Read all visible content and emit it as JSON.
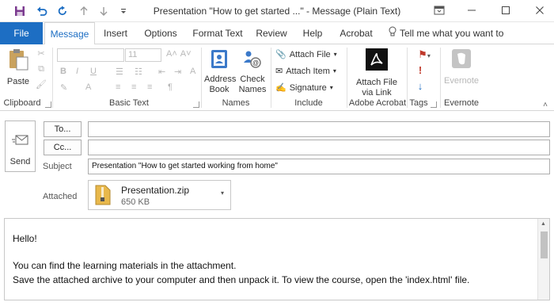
{
  "window": {
    "title": "Presentation \"How to get started ...\"  -  Message (Plain Text)"
  },
  "icons": {
    "save": "save-icon",
    "undo": "undo-icon",
    "redo": "redo-icon",
    "up": "arrow-up-icon",
    "down": "arrow-down-icon",
    "customize": "customize-qat-icon"
  },
  "tabs": [
    "File",
    "Message",
    "Insert",
    "Options",
    "Format Text",
    "Review",
    "Help",
    "Acrobat"
  ],
  "tell_me": "Tell me what you want to do",
  "ribbon": {
    "clipboard": {
      "paste": "Paste",
      "label": "Clipboard"
    },
    "basic_text": {
      "font_size": "11",
      "label": "Basic Text"
    },
    "names": {
      "address_book_1": "Address",
      "address_book_2": "Book",
      "check_names_1": "Check",
      "check_names_2": "Names",
      "label": "Names"
    },
    "include": {
      "attach_file": "Attach File",
      "attach_item": "Attach Item",
      "signature": "Signature",
      "label": "Include"
    },
    "adobe": {
      "line1": "Attach File",
      "line2": "via Link",
      "label": "Adobe Acrobat"
    },
    "tags": {
      "label": "Tags"
    },
    "evernote": {
      "button": "Evernote",
      "label": "Evernote"
    }
  },
  "header": {
    "send": "Send",
    "to": "To...",
    "cc": "Cc...",
    "subject_label": "Subject",
    "subject_value": "Presentation \"How to get started working from home\"",
    "attached_label": "Attached",
    "attachment": {
      "name": "Presentation.zip",
      "size": "650 KB"
    }
  },
  "body": {
    "lines": [
      "Hello!",
      "You can find the learning materials in the attachment.",
      "Save the attached archive to your computer and then unpack it. To view the course, open the 'index.html' file."
    ]
  },
  "colors": {
    "accent": "#1d6ec3",
    "title_icon": "#8a2f8a"
  }
}
